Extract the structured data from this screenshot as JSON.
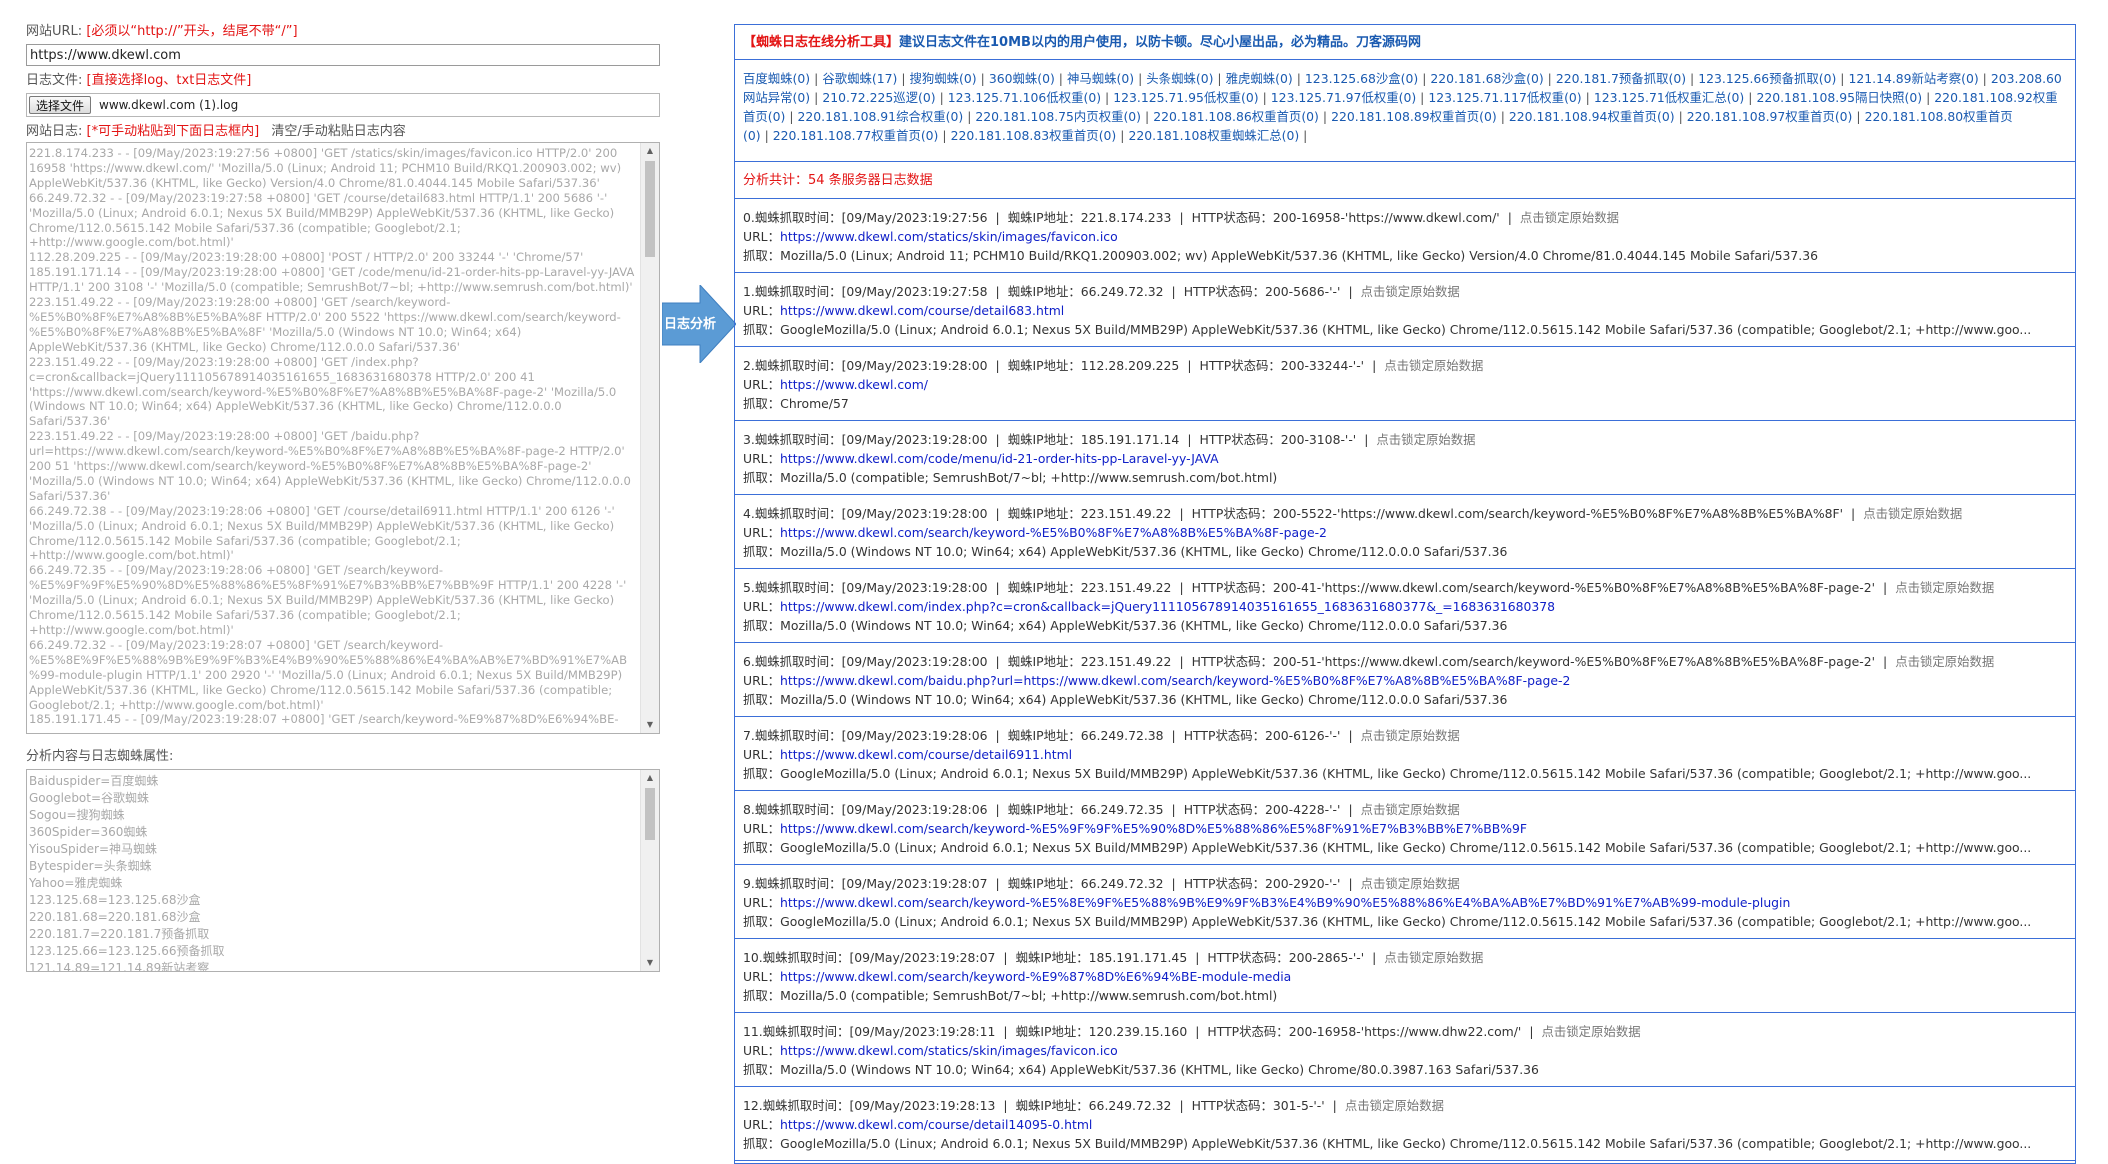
{
  "left": {
    "url_label": "网站URL:",
    "url_hint": "[必须以“http://”开头，结尾不带“/”]",
    "url_value": "https://www.dkewl.com",
    "file_label": "日志文件:",
    "file_hint": "[直接选择log、txt日志文件]",
    "file_button": "选择文件",
    "file_name": "www.dkewl.com (1).log",
    "log_label": "网站日志:",
    "log_hint": "[*可手动粘贴到下面日志框内]",
    "log_action": "清空/手动粘贴日志内容",
    "log_text": "221.8.174.233 - - [09/May/2023:19:27:56 +0800] 'GET /statics/skin/images/favicon.ico HTTP/2.0' 200 16958 'https://www.dkewl.com/' 'Mozilla/5.0 (Linux; Android 11; PCHM10 Build/RKQ1.200903.002; wv) AppleWebKit/537.36 (KHTML, like Gecko) Version/4.0 Chrome/81.0.4044.145 Mobile Safari/537.36'\n66.249.72.32 - - [09/May/2023:19:27:58 +0800] 'GET /course/detail683.html HTTP/1.1' 200 5686 '-' 'Mozilla/5.0 (Linux; Android 6.0.1; Nexus 5X Build/MMB29P) AppleWebKit/537.36 (KHTML, like Gecko) Chrome/112.0.5615.142 Mobile Safari/537.36 (compatible; Googlebot/2.1; +http://www.google.com/bot.html)'\n112.28.209.225 - - [09/May/2023:19:28:00 +0800] 'POST / HTTP/2.0' 200 33244 '-' 'Chrome/57'\n185.191.171.14 - - [09/May/2023:19:28:00 +0800] 'GET /code/menu/id-21-order-hits-pp-Laravel-yy-JAVA HTTP/1.1' 200 3108 '-' 'Mozilla/5.0 (compatible; SemrushBot/7~bl; +http://www.semrush.com/bot.html)'\n223.151.49.22 - - [09/May/2023:19:28:00 +0800] 'GET /search/keyword-%E5%B0%8F%E7%A8%8B%E5%BA%8F HTTP/2.0' 200 5522 'https://www.dkewl.com/search/keyword-%E5%B0%8F%E7%A8%8B%E5%BA%8F' 'Mozilla/5.0 (Windows NT 10.0; Win64; x64) AppleWebKit/537.36 (KHTML, like Gecko) Chrome/112.0.0.0 Safari/537.36'\n223.151.49.22 - - [09/May/2023:19:28:00 +0800] 'GET /index.php?c=cron&callback=jQuery111105678914035161655_1683631680378 HTTP/2.0' 200 41 'https://www.dkewl.com/search/keyword-%E5%B0%8F%E7%A8%8B%E5%BA%8F-page-2' 'Mozilla/5.0 (Windows NT 10.0; Win64; x64) AppleWebKit/537.36 (KHTML, like Gecko) Chrome/112.0.0.0 Safari/537.36'\n223.151.49.22 - - [09/May/2023:19:28:00 +0800] 'GET /baidu.php?url=https://www.dkewl.com/search/keyword-%E5%B0%8F%E7%A8%8B%E5%BA%8F-page-2 HTTP/2.0' 200 51 'https://www.dkewl.com/search/keyword-%E5%B0%8F%E7%A8%8B%E5%BA%8F-page-2' 'Mozilla/5.0 (Windows NT 10.0; Win64; x64) AppleWebKit/537.36 (KHTML, like Gecko) Chrome/112.0.0.0 Safari/537.36'\n66.249.72.38 - - [09/May/2023:19:28:06 +0800] 'GET /course/detail6911.html HTTP/1.1' 200 6126 '-' 'Mozilla/5.0 (Linux; Android 6.0.1; Nexus 5X Build/MMB29P) AppleWebKit/537.36 (KHTML, like Gecko) Chrome/112.0.5615.142 Mobile Safari/537.36 (compatible; Googlebot/2.1; +http://www.google.com/bot.html)'\n66.249.72.35 - - [09/May/2023:19:28:06 +0800] 'GET /search/keyword-%E5%9F%9F%E5%90%8D%E5%88%86%E5%8F%91%E7%B3%BB%E7%BB%9F HTTP/1.1' 200 4228 '-' 'Mozilla/5.0 (Linux; Android 6.0.1; Nexus 5X Build/MMB29P) AppleWebKit/537.36 (KHTML, like Gecko) Chrome/112.0.5615.142 Mobile Safari/537.36 (compatible; Googlebot/2.1; +http://www.google.com/bot.html)'\n66.249.72.32 - - [09/May/2023:19:28:07 +0800] 'GET /search/keyword-%E5%8E%9F%E5%88%9B%E9%9F%B3%E4%B9%90%E5%88%86%E4%BA%AB%E7%BD%91%E7%AB%99-module-plugin HTTP/1.1' 200 2920 '-' 'Mozilla/5.0 (Linux; Android 6.0.1; Nexus 5X Build/MMB29P) AppleWebKit/537.36 (KHTML, like Gecko) Chrome/112.0.5615.142 Mobile Safari/537.36 (compatible; Googlebot/2.1; +http://www.google.com/bot.html)'\n185.191.171.45 - - [09/May/2023:19:28:07 +0800] 'GET /search/keyword-%E9%87%8D%E6%94%BE-",
    "attr_label": "分析内容与日志蜘蛛属性:",
    "attr_text": "Baiduspider=百度蜘蛛\nGooglebot=谷歌蜘蛛\nSogou=搜狗蜘蛛\n360Spider=360蜘蛛\nYisouSpider=神马蜘蛛\nBytespider=头条蜘蛛\nYahoo=雅虎蜘蛛\n123.125.68=123.125.68沙盒\n220.181.68=220.181.68沙盒\n220.181.7=220.181.7预备抓取\n123.125.66=123.125.66预备抓取\n121.14.89=121.14.89新站考察"
  },
  "arrow_label": "日志分析",
  "right": {
    "header_tag": "【蜘蛛日志在线分析工具】",
    "header_text": "建议日志文件在10MB以内的用户使用，以防卡顿。尽心小屋出品，必为精品。刀客源码网",
    "spiders": [
      "百度蜘蛛(0)",
      "谷歌蜘蛛(17)",
      "搜狗蜘蛛(0)",
      "360蜘蛛(0)",
      "神马蜘蛛(0)",
      "头条蜘蛛(0)",
      "雅虎蜘蛛(0)",
      "123.125.68沙盒(0)",
      "220.181.68沙盒(0)",
      "220.181.7预备抓取(0)",
      "123.125.66预备抓取(0)",
      "121.14.89新站考察(0)",
      "203.208.60网站异常(0)",
      "210.72.225巡逻(0)",
      "123.125.71.106低权重(0)",
      "123.125.71.95低权重(0)",
      "123.125.71.97低权重(0)",
      "123.125.71.117低权重(0)",
      "123.125.71低权重汇总(0)",
      "220.181.108.95隔日快照(0)",
      "220.181.108.92权重首页(0)",
      "220.181.108.91综合权重(0)",
      "220.181.108.75内页权重(0)",
      "220.181.108.86权重首页(0)",
      "220.181.108.89权重首页(0)",
      "220.181.108.94权重首页(0)",
      "220.181.108.97权重首页(0)",
      "220.181.108.80权重首页(0)",
      "220.181.108.77权重首页(0)",
      "220.181.108.83权重首页(0)",
      "220.181.108权重蜘蛛汇总(0)"
    ],
    "total_text": "分析共计：54 条服务器日志数据",
    "time_label": "蜘蛛抓取时间：",
    "ip_label": "蜘蛛IP地址：",
    "status_label": "HTTP状态码：",
    "lock_text": "点击锁定原始数据",
    "url_label": "URL：",
    "ua_label": "抓取：",
    "entries": [
      {
        "idx": "0.",
        "time": "[09/May/2023:19:27:56",
        "ip": "221.8.174.233",
        "status": "200-16958-'https://www.dkewl.com/'",
        "url": "https://www.dkewl.com/statics/skin/images/favicon.ico",
        "ua": "Mozilla/5.0 (Linux; Android 11; PCHM10 Build/RKQ1.200903.002; wv) AppleWebKit/537.36 (KHTML, like Gecko) Version/4.0 Chrome/81.0.4044.145 Mobile Safari/537.36"
      },
      {
        "idx": "1.",
        "time": "[09/May/2023:19:27:58",
        "ip": "66.249.72.32",
        "status": "200-5686-'-'",
        "url": "https://www.dkewl.com/course/detail683.html",
        "ua": "GoogleMozilla/5.0 (Linux; Android 6.0.1; Nexus 5X Build/MMB29P) AppleWebKit/537.36 (KHTML, like Gecko) Chrome/112.0.5615.142 Mobile Safari/537.36 (compatible; Googlebot/2.1; +http://www.goo..."
      },
      {
        "idx": "2.",
        "time": "[09/May/2023:19:28:00",
        "ip": "112.28.209.225",
        "status": "200-33244-'-'",
        "url": "https://www.dkewl.com/",
        "ua": "Chrome/57"
      },
      {
        "idx": "3.",
        "time": "[09/May/2023:19:28:00",
        "ip": "185.191.171.14",
        "status": "200-3108-'-'",
        "url": "https://www.dkewl.com/code/menu/id-21-order-hits-pp-Laravel-yy-JAVA",
        "ua": "Mozilla/5.0 (compatible; SemrushBot/7~bl; +http://www.semrush.com/bot.html)"
      },
      {
        "idx": "4.",
        "time": "[09/May/2023:19:28:00",
        "ip": "223.151.49.22",
        "status": "200-5522-'https://www.dkewl.com/search/keyword-%E5%B0%8F%E7%A8%8B%E5%BA%8F'",
        "url": "https://www.dkewl.com/search/keyword-%E5%B0%8F%E7%A8%8B%E5%BA%8F-page-2",
        "ua": "Mozilla/5.0 (Windows NT 10.0; Win64; x64) AppleWebKit/537.36 (KHTML, like Gecko) Chrome/112.0.0.0 Safari/537.36"
      },
      {
        "idx": "5.",
        "time": "[09/May/2023:19:28:00",
        "ip": "223.151.49.22",
        "status": "200-41-'https://www.dkewl.com/search/keyword-%E5%B0%8F%E7%A8%8B%E5%BA%8F-page-2'",
        "url": "https://www.dkewl.com/index.php?c=cron&callback=jQuery111105678914035161655_1683631680377&_=1683631680378",
        "ua": "Mozilla/5.0 (Windows NT 10.0; Win64; x64) AppleWebKit/537.36 (KHTML, like Gecko) Chrome/112.0.0.0 Safari/537.36"
      },
      {
        "idx": "6.",
        "time": "[09/May/2023:19:28:00",
        "ip": "223.151.49.22",
        "status": "200-51-'https://www.dkewl.com/search/keyword-%E5%B0%8F%E7%A8%8B%E5%BA%8F-page-2'",
        "url": "https://www.dkewl.com/baidu.php?url=https://www.dkewl.com/search/keyword-%E5%B0%8F%E7%A8%8B%E5%BA%8F-page-2",
        "ua": "Mozilla/5.0 (Windows NT 10.0; Win64; x64) AppleWebKit/537.36 (KHTML, like Gecko) Chrome/112.0.0.0 Safari/537.36"
      },
      {
        "idx": "7.",
        "time": "[09/May/2023:19:28:06",
        "ip": "66.249.72.38",
        "status": "200-6126-'-'",
        "url": "https://www.dkewl.com/course/detail6911.html",
        "ua": "GoogleMozilla/5.0 (Linux; Android 6.0.1; Nexus 5X Build/MMB29P) AppleWebKit/537.36 (KHTML, like Gecko) Chrome/112.0.5615.142 Mobile Safari/537.36 (compatible; Googlebot/2.1; +http://www.goo..."
      },
      {
        "idx": "8.",
        "time": "[09/May/2023:19:28:06",
        "ip": "66.249.72.35",
        "status": "200-4228-'-'",
        "url": "https://www.dkewl.com/search/keyword-%E5%9F%9F%E5%90%8D%E5%88%86%E5%8F%91%E7%B3%BB%E7%BB%9F",
        "ua": "GoogleMozilla/5.0 (Linux; Android 6.0.1; Nexus 5X Build/MMB29P) AppleWebKit/537.36 (KHTML, like Gecko) Chrome/112.0.5615.142 Mobile Safari/537.36 (compatible; Googlebot/2.1; +http://www.goo..."
      },
      {
        "idx": "9.",
        "time": "[09/May/2023:19:28:07",
        "ip": "66.249.72.32",
        "status": "200-2920-'-'",
        "url": "https://www.dkewl.com/search/keyword-%E5%8E%9F%E5%88%9B%E9%9F%B3%E4%B9%90%E5%88%86%E4%BA%AB%E7%BD%91%E7%AB%99-module-plugin",
        "ua": "GoogleMozilla/5.0 (Linux; Android 6.0.1; Nexus 5X Build/MMB29P) AppleWebKit/537.36 (KHTML, like Gecko) Chrome/112.0.5615.142 Mobile Safari/537.36 (compatible; Googlebot/2.1; +http://www.goo..."
      },
      {
        "idx": "10.",
        "time": "[09/May/2023:19:28:07",
        "ip": "185.191.171.45",
        "status": "200-2865-'-'",
        "url": "https://www.dkewl.com/search/keyword-%E9%87%8D%E6%94%BE-module-media",
        "ua": "Mozilla/5.0 (compatible; SemrushBot/7~bl; +http://www.semrush.com/bot.html)"
      },
      {
        "idx": "11.",
        "time": "[09/May/2023:19:28:11",
        "ip": "120.239.15.160",
        "status": "200-16958-'https://www.dhw22.com/'",
        "url": "https://www.dkewl.com/statics/skin/images/favicon.ico",
        "ua": "Mozilla/5.0 (Windows NT 10.0; Win64; x64) AppleWebKit/537.36 (KHTML, like Gecko) Chrome/80.0.3987.163 Safari/537.36"
      },
      {
        "idx": "12.",
        "time": "[09/May/2023:19:28:13",
        "ip": "66.249.72.32",
        "status": "301-5-'-'",
        "url": "https://www.dkewl.com/course/detail14095-0.html",
        "ua": "GoogleMozilla/5.0 (Linux; Android 6.0.1; Nexus 5X Build/MMB29P) AppleWebKit/537.36 (KHTML, like Gecko) Chrome/112.0.5615.142 Mobile Safari/537.36 (compatible; Googlebot/2.1; +http://www.goo..."
      }
    ]
  },
  "colors": {
    "accent": "#3b6fd8",
    "link": "#1020c8",
    "brand": "#1a5ab0",
    "warn": "#e31414",
    "arrow": "#5b9bd5"
  }
}
